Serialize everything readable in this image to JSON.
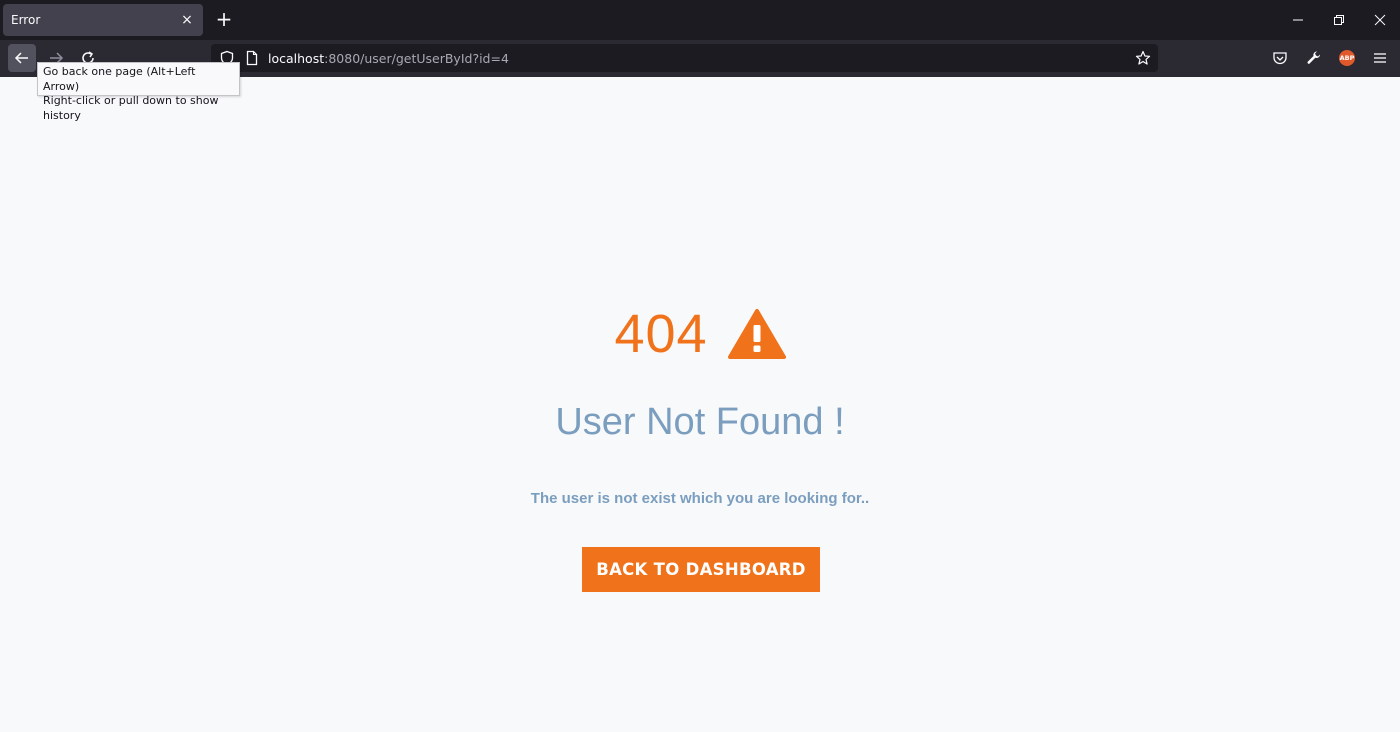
{
  "browser": {
    "tab_title": "Error",
    "tab_close": "×",
    "new_tab": "+",
    "url_host": "localhost",
    "url_path": ":8080/user/getUserById?id=4",
    "tooltip_line1": "Go back one page (Alt+Left Arrow)",
    "tooltip_line2": "Right-click or pull down to show history",
    "abp_label": "ABP"
  },
  "page": {
    "error_code": "404",
    "heading": "User Not Found !",
    "message": "The user is not exist which you are looking for..",
    "button_label": "BACK TO DASHBOARD"
  },
  "colors": {
    "accent": "#f0721a",
    "muted_text": "#7b9ebf",
    "page_background": "#f8f9fb"
  }
}
